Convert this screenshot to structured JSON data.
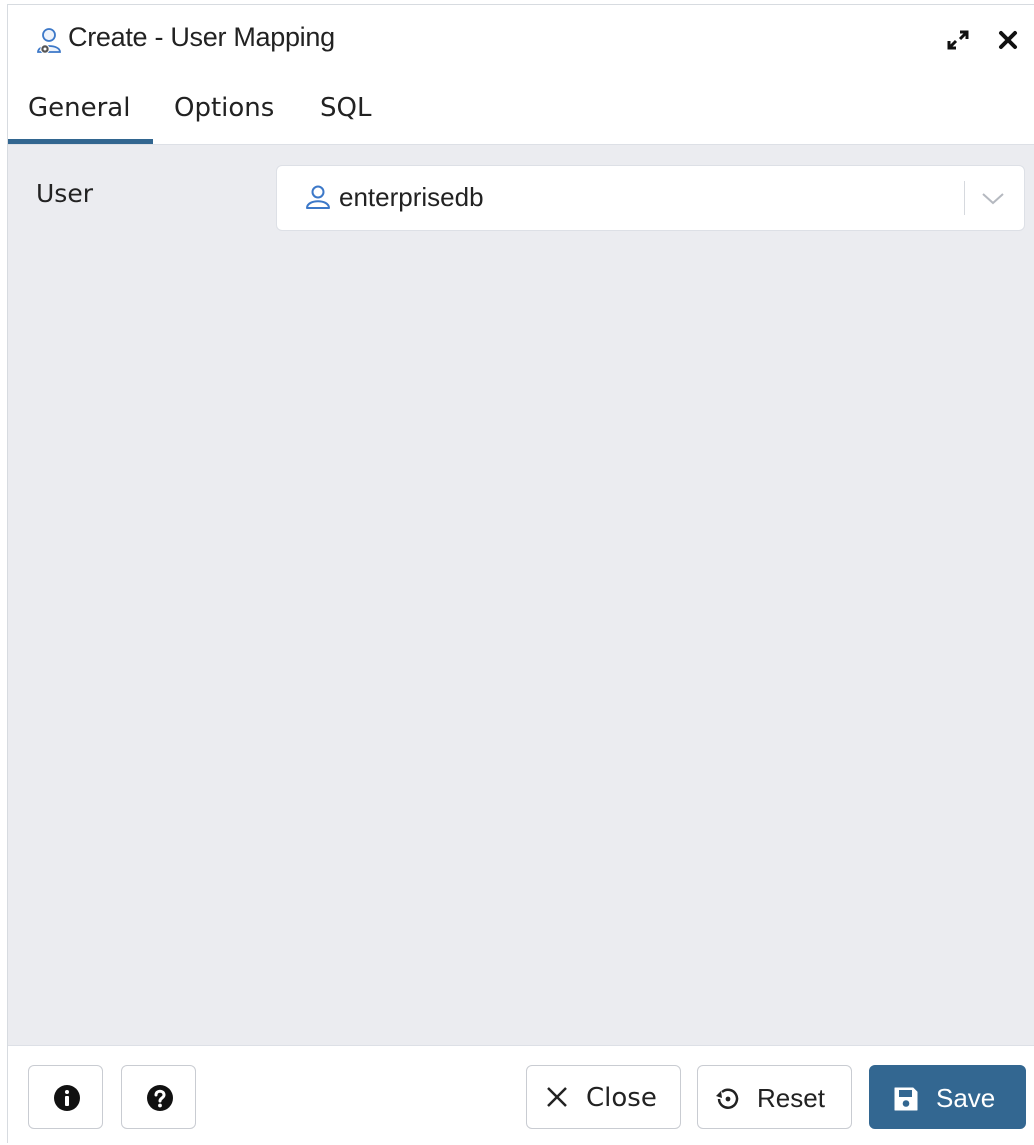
{
  "dialog": {
    "title": "Create - User Mapping",
    "title_icon": "user-mapping-icon",
    "maximize_icon": "maximize-icon",
    "close_icon": "close-icon"
  },
  "tabs": [
    {
      "label": "General",
      "active": true
    },
    {
      "label": "Options",
      "active": false
    },
    {
      "label": "SQL",
      "active": false
    }
  ],
  "general": {
    "user_label": "User",
    "user_value": "enterprisedb",
    "user_icon": "user-icon",
    "dropdown_icon": "chevron-down-icon"
  },
  "footer": {
    "info_icon": "info-icon",
    "help_icon": "help-icon",
    "close_label": "Close",
    "reset_label": "Reset",
    "save_label": "Save"
  },
  "colors": {
    "accent": "#326690",
    "content_bg": "#ebecf0",
    "save_bg": "#336791"
  }
}
